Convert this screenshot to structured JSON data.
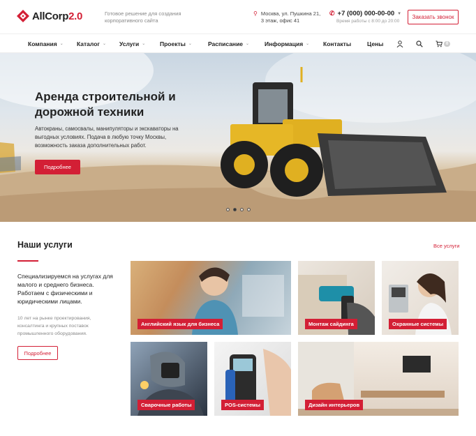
{
  "brand": {
    "name": "AllCorp",
    "version": "2.0",
    "tagline": "Готовое решение для создания корпоративного сайта"
  },
  "header": {
    "address_line1": "Москва, ул. Пушкина 21,",
    "address_line2": "3 этаж, офис 41",
    "phone": "+7 (000) 000-00-00",
    "hours": "Время работы с 8:00 до 20:00",
    "callback_label": "Заказать звонок"
  },
  "nav": {
    "items": [
      {
        "label": "Компания",
        "dropdown": true
      },
      {
        "label": "Каталог",
        "dropdown": true
      },
      {
        "label": "Услуги",
        "dropdown": true
      },
      {
        "label": "Проекты",
        "dropdown": true
      },
      {
        "label": "Расписание",
        "dropdown": true
      },
      {
        "label": "Информация",
        "dropdown": true
      },
      {
        "label": "Контакты",
        "dropdown": false
      },
      {
        "label": "Цены",
        "dropdown": false
      }
    ],
    "cart_count": "0",
    "icons": [
      "user-icon",
      "search-icon",
      "cart-icon"
    ]
  },
  "hero": {
    "title": "Аренда строительной и дорожной техники",
    "text": "Автокраны, самосвалы, манипуляторы и экскаваторы на выгодных условиях. Подача в любую точку Москвы, возможность заказа дополнительных работ.",
    "button_label": "Подробнее",
    "slides_total": 4,
    "active_slide": 2
  },
  "services": {
    "title": "Наши услуги",
    "all_link": "Все услуги",
    "lead": "Специализируемся на услугах для малого и среднего бизнеса. Работаем с физическими и юридическими лицами.",
    "sub": "10 лет на рынке проектирования, консалтинга и крупных поставок промышленного оборудования.",
    "button_label": "Подробнее",
    "cards": [
      {
        "label": "Английский язык для бизнеса"
      },
      {
        "label": "Монтаж сайдинга"
      },
      {
        "label": "Охранные системы"
      },
      {
        "label": "Сварочные работы"
      },
      {
        "label": "POS-системы"
      },
      {
        "label": "Дизайн интерьеров"
      }
    ]
  },
  "colors": {
    "accent": "#d31f35",
    "text": "#222222",
    "muted": "#888888"
  }
}
